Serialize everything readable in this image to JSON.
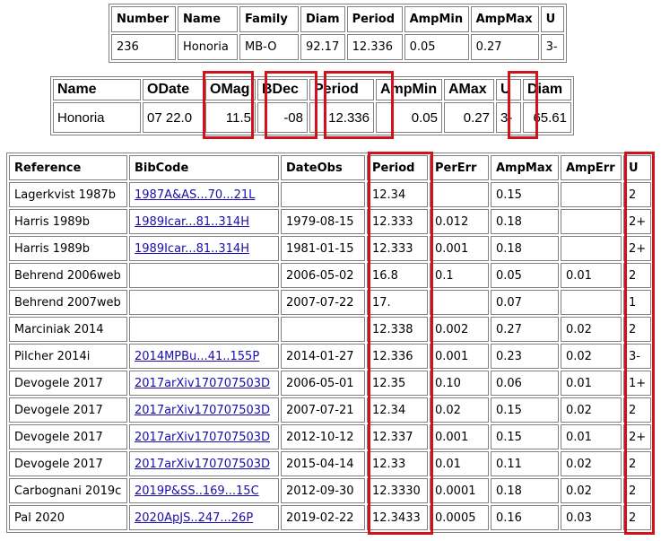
{
  "summary_table": {
    "headers": [
      "Number",
      "Name",
      "Family",
      "Diam",
      "Period",
      "AmpMin",
      "AmpMax",
      "U"
    ],
    "row": [
      "236",
      "Honoria",
      "MB-O",
      "92.17",
      "12.336",
      "0.05",
      "0.27",
      "3-"
    ]
  },
  "detail_table": {
    "headers": [
      "Name",
      "ODate",
      "OMag",
      "BDec",
      "Period",
      "AmpMin",
      "AMax",
      "U",
      "Diam"
    ],
    "row": [
      "Honoria",
      "07 22.0",
      "11.5",
      "-08",
      "12.336",
      "0.05",
      "0.27",
      "3-",
      "65.61"
    ]
  },
  "references_table": {
    "headers": [
      "Reference",
      "BibCode",
      "DateObs",
      "Period",
      "PerErr",
      "AmpMax",
      "AmpErr",
      "U"
    ],
    "rows": [
      [
        "Lagerkvist 1987b",
        "1987A&AS...70...21L",
        "",
        "12.34",
        "",
        "0.15",
        "",
        "2"
      ],
      [
        "Harris 1989b",
        "1989Icar...81..314H",
        "1979-08-15",
        "12.333",
        "0.012",
        "0.18",
        "",
        "2+"
      ],
      [
        "Harris 1989b",
        "1989Icar...81..314H",
        "1981-01-15",
        "12.333",
        "0.001",
        "0.18",
        "",
        "2+"
      ],
      [
        "Behrend 2006web",
        "",
        "2006-05-02",
        "16.8",
        "0.1",
        "0.05",
        "0.01",
        "2"
      ],
      [
        "Behrend 2007web",
        "",
        "2007-07-22",
        "17.",
        "",
        "0.07",
        "",
        "1"
      ],
      [
        "Marciniak 2014",
        "",
        "",
        "12.338",
        "0.002",
        "0.27",
        "0.02",
        "2"
      ],
      [
        "Pilcher 2014i",
        "2014MPBu...41..155P",
        "2014-01-27",
        "12.336",
        "0.001",
        "0.23",
        "0.02",
        "3-"
      ],
      [
        "Devogele 2017",
        "2017arXiv170707503D",
        "2006-05-01",
        "12.35",
        "0.10",
        "0.06",
        "0.01",
        "1+"
      ],
      [
        "Devogele 2017",
        "2017arXiv170707503D",
        "2007-07-21",
        "12.34",
        "0.02",
        "0.15",
        "0.02",
        "2"
      ],
      [
        "Devogele 2017",
        "2017arXiv170707503D",
        "2012-10-12",
        "12.337",
        "0.001",
        "0.15",
        "0.01",
        "2+"
      ],
      [
        "Devogele 2017",
        "2017arXiv170707503D",
        "2015-04-14",
        "12.33",
        "0.01",
        "0.11",
        "0.02",
        "2"
      ],
      [
        "Carbognani 2019c",
        "2019P&SS..169...15C",
        "2012-09-30",
        "12.3330",
        "0.0001",
        "0.18",
        "0.02",
        "2"
      ],
      [
        "Pal 2020",
        "2020ApJS..247...26P",
        "2019-02-22",
        "12.3433",
        "0.0005",
        "0.16",
        "0.03",
        "2"
      ]
    ]
  },
  "highlight_color": "#d0121b",
  "link_color": "#1a0dab"
}
